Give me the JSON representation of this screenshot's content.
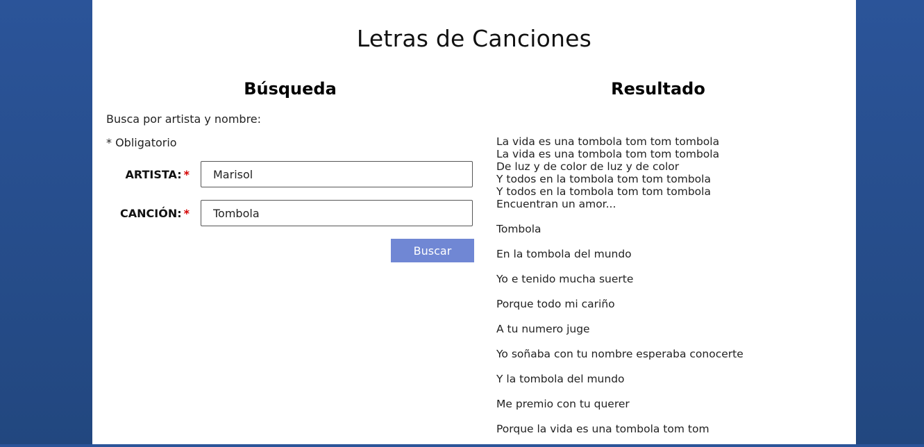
{
  "page": {
    "title": "Letras de Canciones"
  },
  "search": {
    "heading": "Búsqueda",
    "intro": "Busca por artista y nombre:",
    "required_note": "* Obligatorio",
    "artist_label": "ARTISTA:",
    "artist_value": "Marisol",
    "song_label": "CANCIÓN:",
    "song_value": "Tombola",
    "required_marker": "*",
    "button_label": "Buscar"
  },
  "result": {
    "heading": "Resultado",
    "block_lines": [
      "La vida es una tombola tom tom tombola",
      "La vida es una tombola tom tom tombola",
      "De luz y de color de luz y de color",
      "Y todos en la tombola tom tom tombola",
      "Y todos en la tombola tom tom tombola",
      "Encuentran un amor..."
    ],
    "lines": [
      "Tombola",
      "En la tombola del mundo",
      "Yo e tenido mucha suerte",
      "Porque todo mi cariño",
      "A tu numero juge",
      "Yo soñaba con tu nombre esperaba conocerte",
      "Y la tombola del mundo",
      "Me premio con tu querer",
      "Porque la vida es una tombola tom tom"
    ]
  }
}
